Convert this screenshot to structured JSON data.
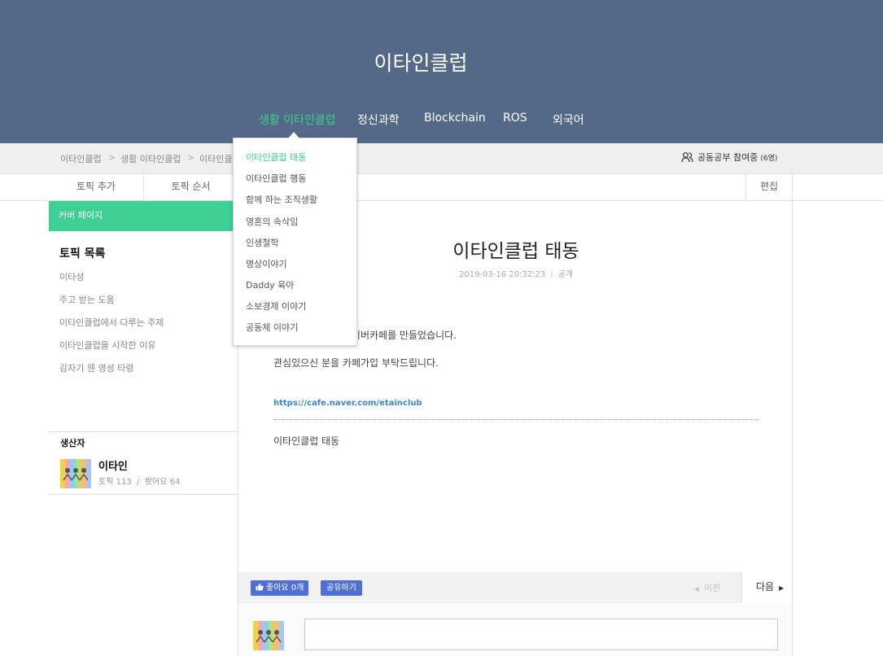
{
  "site": {
    "title": "이타인클럽"
  },
  "gnb": {
    "items": [
      "생활 이타인클럽",
      "정신과학",
      "Blockchain",
      "ROS",
      "외국어"
    ]
  },
  "breadcrumb": {
    "items": [
      "이타인클럽",
      "생활 이타인클럽",
      "이타인클"
    ],
    "separator": ">"
  },
  "study": {
    "label": "공동공부 참여중",
    "count": "(6명)",
    "icon": "people-icon"
  },
  "toolbar": {
    "add_topic": "토픽 추가",
    "topic_order": "토픽 순서",
    "edit": "편집"
  },
  "sidebar": {
    "cover_link": "커버 페이지",
    "topic_heading": "토픽 목록",
    "topics": [
      "이타성",
      "주고 받는 도움",
      "이타인클럽에서 다루는 주제",
      "이타인클럽을 시작한 이유",
      "감자기 웬 영성 타령"
    ]
  },
  "producer": {
    "label": "생산자",
    "name": "이타인",
    "topics_label": "토픽",
    "topics_count": "113",
    "likes_label": "봤어요",
    "likes_count": "64",
    "separator": "/"
  },
  "post": {
    "title": "이타인클럽 태동",
    "date": "2019-03-16 20:32:23",
    "meta_sep": "|",
    "visibility": "공개",
    "line1": "위해 네이버카페를 만들었습니다.",
    "line2": "관심있으신 분을 카페가입 부탁드립니다.",
    "link": "https://cafe.naver.com/etainclub",
    "tail": "이타인클럽 태동"
  },
  "actions": {
    "like": "좋아요 0개",
    "share": "공유하기",
    "prev": "이전",
    "next": "다음"
  },
  "dropdown": {
    "items": [
      "이타인클럽 태동",
      "이타인클럽 행동",
      "함께 하는 조직생활",
      "영혼의 속삭임",
      "인생철학",
      "명상이야기",
      "Daddy 육아",
      "소보경제 이야기",
      "공동체 이야기"
    ],
    "active_index": 0
  },
  "colors": {
    "header_bg": "#536987",
    "accent": "#3ecf94",
    "button_blue": "#4e6fd6",
    "link_blue": "#3b84d6"
  }
}
